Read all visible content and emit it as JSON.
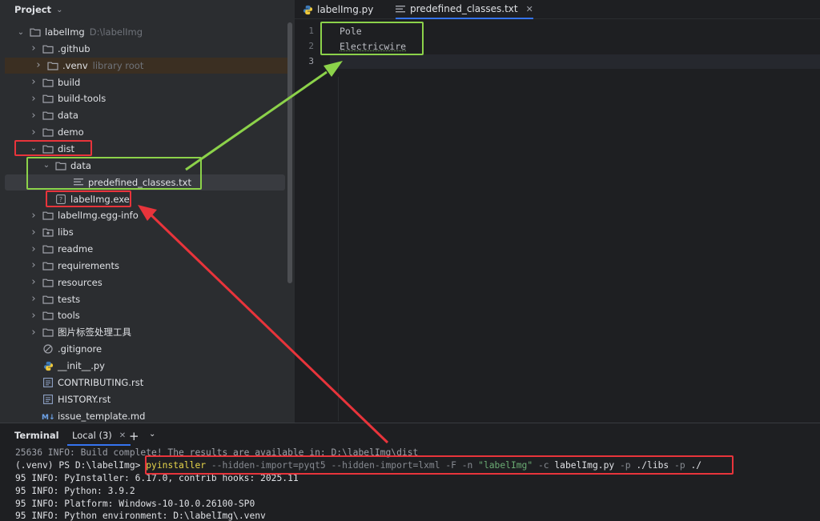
{
  "project": {
    "title": "Project",
    "tree": [
      {
        "label": "labelImg",
        "hint": "D:\\labelImg",
        "icon": "folder-icon",
        "arrow": "expanded",
        "depth": 0
      },
      {
        "label": ".github",
        "hint": "",
        "icon": "folder-icon",
        "arrow": "collapsed",
        "depth": 1
      },
      {
        "label": ".venv",
        "hint": "library root",
        "icon": "folder-icon",
        "arrow": "collapsed",
        "depth": 1
      },
      {
        "label": "build",
        "hint": "",
        "icon": "folder-icon",
        "arrow": "collapsed",
        "depth": 1
      },
      {
        "label": "build-tools",
        "hint": "",
        "icon": "folder-icon",
        "arrow": "collapsed",
        "depth": 1
      },
      {
        "label": "data",
        "hint": "",
        "icon": "folder-icon",
        "arrow": "collapsed",
        "depth": 1
      },
      {
        "label": "demo",
        "hint": "",
        "icon": "folder-icon",
        "arrow": "collapsed",
        "depth": 1
      },
      {
        "label": "dist",
        "hint": "",
        "icon": "folder-icon",
        "arrow": "expanded",
        "depth": 1
      },
      {
        "label": "data",
        "hint": "",
        "icon": "folder-icon",
        "arrow": "expanded",
        "depth": 2
      },
      {
        "label": "predefined_classes.txt",
        "hint": "",
        "icon": "text-file-icon",
        "arrow": "none",
        "depth": 3
      },
      {
        "label": "labelImg.exe",
        "hint": "",
        "icon": "unknown-file-icon",
        "arrow": "none",
        "depth": 2
      },
      {
        "label": "labelImg.egg-info",
        "hint": "",
        "icon": "folder-icon",
        "arrow": "collapsed",
        "depth": 1
      },
      {
        "label": "libs",
        "hint": "",
        "icon": "package-folder-icon",
        "arrow": "collapsed",
        "depth": 1
      },
      {
        "label": "readme",
        "hint": "",
        "icon": "folder-icon",
        "arrow": "collapsed",
        "depth": 1
      },
      {
        "label": "requirements",
        "hint": "",
        "icon": "folder-icon",
        "arrow": "collapsed",
        "depth": 1
      },
      {
        "label": "resources",
        "hint": "",
        "icon": "folder-icon",
        "arrow": "collapsed",
        "depth": 1
      },
      {
        "label": "tests",
        "hint": "",
        "icon": "folder-icon",
        "arrow": "collapsed",
        "depth": 1
      },
      {
        "label": "tools",
        "hint": "",
        "icon": "folder-icon",
        "arrow": "collapsed",
        "depth": 1
      },
      {
        "label": "图片标签处理工具",
        "hint": "",
        "icon": "folder-icon",
        "arrow": "collapsed",
        "depth": 1
      },
      {
        "label": ".gitignore",
        "hint": "",
        "icon": "ignore-file-icon",
        "arrow": "none",
        "depth": 1
      },
      {
        "label": "__init__.py",
        "hint": "",
        "icon": "python-file-icon",
        "arrow": "none",
        "depth": 1
      },
      {
        "label": "CONTRIBUTING.rst",
        "hint": "",
        "icon": "rst-file-icon",
        "arrow": "none",
        "depth": 1
      },
      {
        "label": "HISTORY.rst",
        "hint": "",
        "icon": "rst-file-icon",
        "arrow": "none",
        "depth": 1
      },
      {
        "label": "issue_template.md",
        "hint": "",
        "icon": "markdown-file-icon",
        "arrow": "none",
        "depth": 1
      }
    ]
  },
  "editor": {
    "tabs": [
      {
        "label": "labelImg.py",
        "icon": "python-file-icon",
        "active": false
      },
      {
        "label": "predefined_classes.txt",
        "icon": "text-file-icon",
        "active": true
      }
    ],
    "tab_close": "✕",
    "lines": [
      {
        "number": "1",
        "text": "Pole"
      },
      {
        "number": "2",
        "text": "Electricwire"
      },
      {
        "number": "3",
        "text": ""
      }
    ]
  },
  "terminal": {
    "title": "Terminal",
    "tab_label": "Local (3)",
    "tab_close": "✕",
    "new_tab": "+",
    "menu": "⌄",
    "lines": {
      "l0": "25636 INFO: Build complete! The results are available in: D:\\labelImg\\dist",
      "prompt": "(.venv) PS D:\\labelImg> ",
      "cmd_pyinstaller": "pyinstaller",
      "cmd_opts1": " --hidden-import=pyqt5 --hidden-import=lxml -F -n ",
      "cmd_name": "\"labelImg\"",
      "cmd_opt_c": " -c ",
      "cmd_file": "labelImg.py",
      "cmd_opt_p1": " -p ",
      "cmd_libs": "./libs",
      "cmd_opt_p2": " -p ",
      "cmd_dot": "./",
      "l2": "95 INFO: PyInstaller: 6.17.0, contrib hooks: 2025.11",
      "l3": "95 INFO: Python: 3.9.2",
      "l4": "95 INFO: Platform: Windows-10-10.0.26100-SP0",
      "l5": "95 INFO: Python environment: D:\\labelImg\\.venv"
    }
  },
  "colors": {
    "annotation_red": "#e8343b",
    "annotation_green": "#8cd24a",
    "accent_blue": "#3574f0"
  }
}
